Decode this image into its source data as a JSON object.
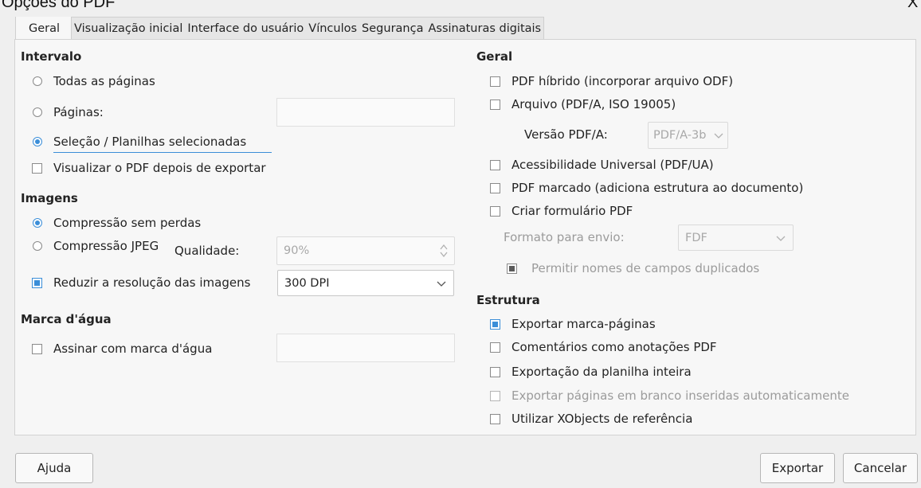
{
  "window": {
    "title": "Opções do PDF",
    "close_label": "X"
  },
  "tabs": [
    "Geral",
    "Visualização inicial",
    "Interface do usuário",
    "Vínculos",
    "Segurança",
    "Assinaturas digitais"
  ],
  "range": {
    "heading": "Intervalo",
    "all_pages": "Todas as páginas",
    "pages": "Páginas:",
    "pages_value": "",
    "selection": "Seleção / Planilhas selecionadas",
    "view_pdf": "Visualizar o PDF depois de exportar"
  },
  "images": {
    "heading": "Imagens",
    "lossless": "Compressão sem perdas",
    "jpeg": "Compressão JPEG",
    "quality_label": "Qualidade:",
    "quality_value": "90%",
    "reduce": "Reduzir a resolução das imagens",
    "dpi_value": "300 DPI"
  },
  "watermark": {
    "heading": "Marca d'água",
    "sign": "Assinar com marca d'água",
    "value": ""
  },
  "general": {
    "heading": "Geral",
    "hybrid": "PDF híbrido (incorporar arquivo ODF)",
    "archive": "Arquivo (PDF/A, ISO 19005)",
    "pdfa_version_label": "Versão PDF/A:",
    "pdfa_version_value": "PDF/A-3b",
    "universal": "Acessibilidade Universal (PDF/UA)",
    "tagged": "PDF marcado (adiciona estrutura ao documento)",
    "create_form": "Criar formulário PDF",
    "submit_format_label": "Formato para envio:",
    "submit_format_value": "FDF",
    "allow_duplicates": "Permitir nomes de campos duplicados"
  },
  "structure": {
    "heading": "Estrutura",
    "bookmarks": "Exportar marca-páginas",
    "comments": "Comentários como anotações PDF",
    "whole_sheet": "Exportação da planilha inteira",
    "blank_pages": "Exportar páginas em branco inseridas automaticamente",
    "xobjects": "Utilizar XObjects de referência"
  },
  "buttons": {
    "help": "Ajuda",
    "export": "Exportar",
    "cancel": "Cancelar"
  },
  "colors": {
    "accent": "#3b8ed8",
    "panel": "#f7f7f7",
    "window": "#efefef"
  }
}
